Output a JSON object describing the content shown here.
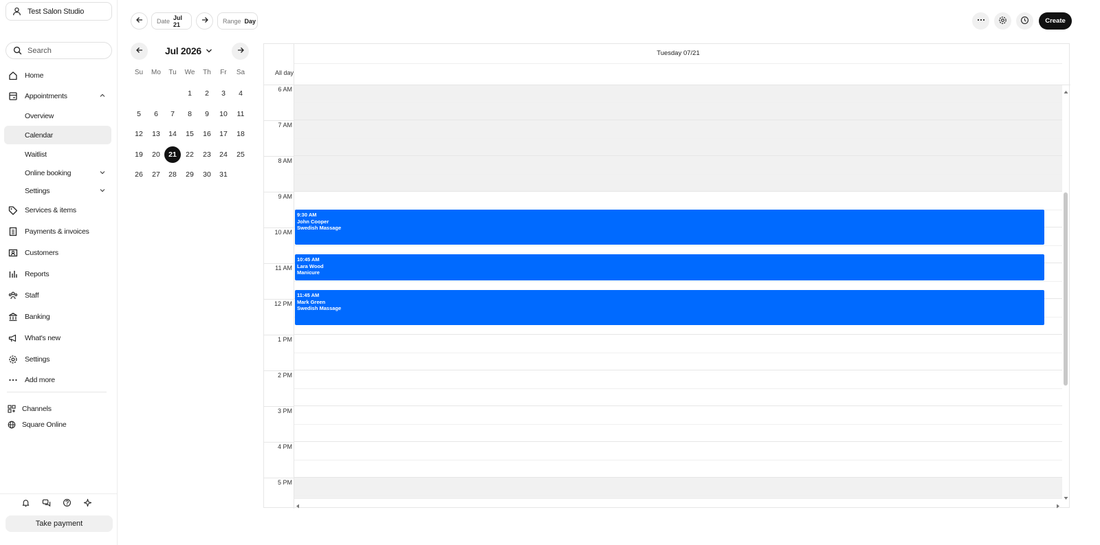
{
  "business": {
    "name": "Test Salon Studio"
  },
  "search": {
    "placeholder": "Search"
  },
  "nav": {
    "home": "Home",
    "appointments": "Appointments",
    "overview": "Overview",
    "calendar": "Calendar",
    "waitlist": "Waitlist",
    "online_booking": "Online booking",
    "appt_settings": "Settings",
    "services": "Services & items",
    "payments": "Payments & invoices",
    "customers": "Customers",
    "reports": "Reports",
    "staff": "Staff",
    "banking": "Banking",
    "whats_new": "What's new",
    "settings": "Settings",
    "add_more": "Add more",
    "channels": "Channels",
    "square_online": "Square Online"
  },
  "take_payment": "Take payment",
  "toolbar": {
    "date_label": "Date",
    "date_value": "Jul 21",
    "range_label": "Range",
    "range_value": "Day",
    "create_label": "Create"
  },
  "mini_calendar": {
    "title": "Jul 2026",
    "weekdays": [
      "Su",
      "Mo",
      "Tu",
      "We",
      "Th",
      "Fr",
      "Sa"
    ],
    "days": [
      "1",
      "2",
      "3",
      "4",
      "5",
      "6",
      "7",
      "8",
      "9",
      "10",
      "11",
      "12",
      "13",
      "14",
      "15",
      "16",
      "17",
      "18",
      "19",
      "20",
      "21",
      "22",
      "23",
      "24",
      "25",
      "26",
      "27",
      "28",
      "29",
      "30",
      "31"
    ],
    "selected_day": "21"
  },
  "day_view": {
    "column_title": "Tuesday 07/21",
    "all_day_label": "All day",
    "hours": [
      "6 AM",
      "7 AM",
      "8 AM",
      "9 AM",
      "10 AM",
      "11 AM",
      "12 PM",
      "1 PM",
      "2 PM",
      "3 PM",
      "4 PM",
      "5 PM"
    ],
    "appointments": [
      {
        "time": "9:30 AM",
        "customer": "John Cooper",
        "service": "Swedish Massage",
        "color": "#006aff"
      },
      {
        "time": "10:45 AM",
        "customer": "Lara Wood",
        "service": "Manicure",
        "color": "#006aff"
      },
      {
        "time": "11:45 AM",
        "customer": "Mark Green",
        "service": "Swedish Massage",
        "color": "#006aff"
      }
    ]
  },
  "colors": {
    "accent": "#006aff",
    "primary_button": "#111111",
    "closed_hours": "#f1f1f1"
  }
}
